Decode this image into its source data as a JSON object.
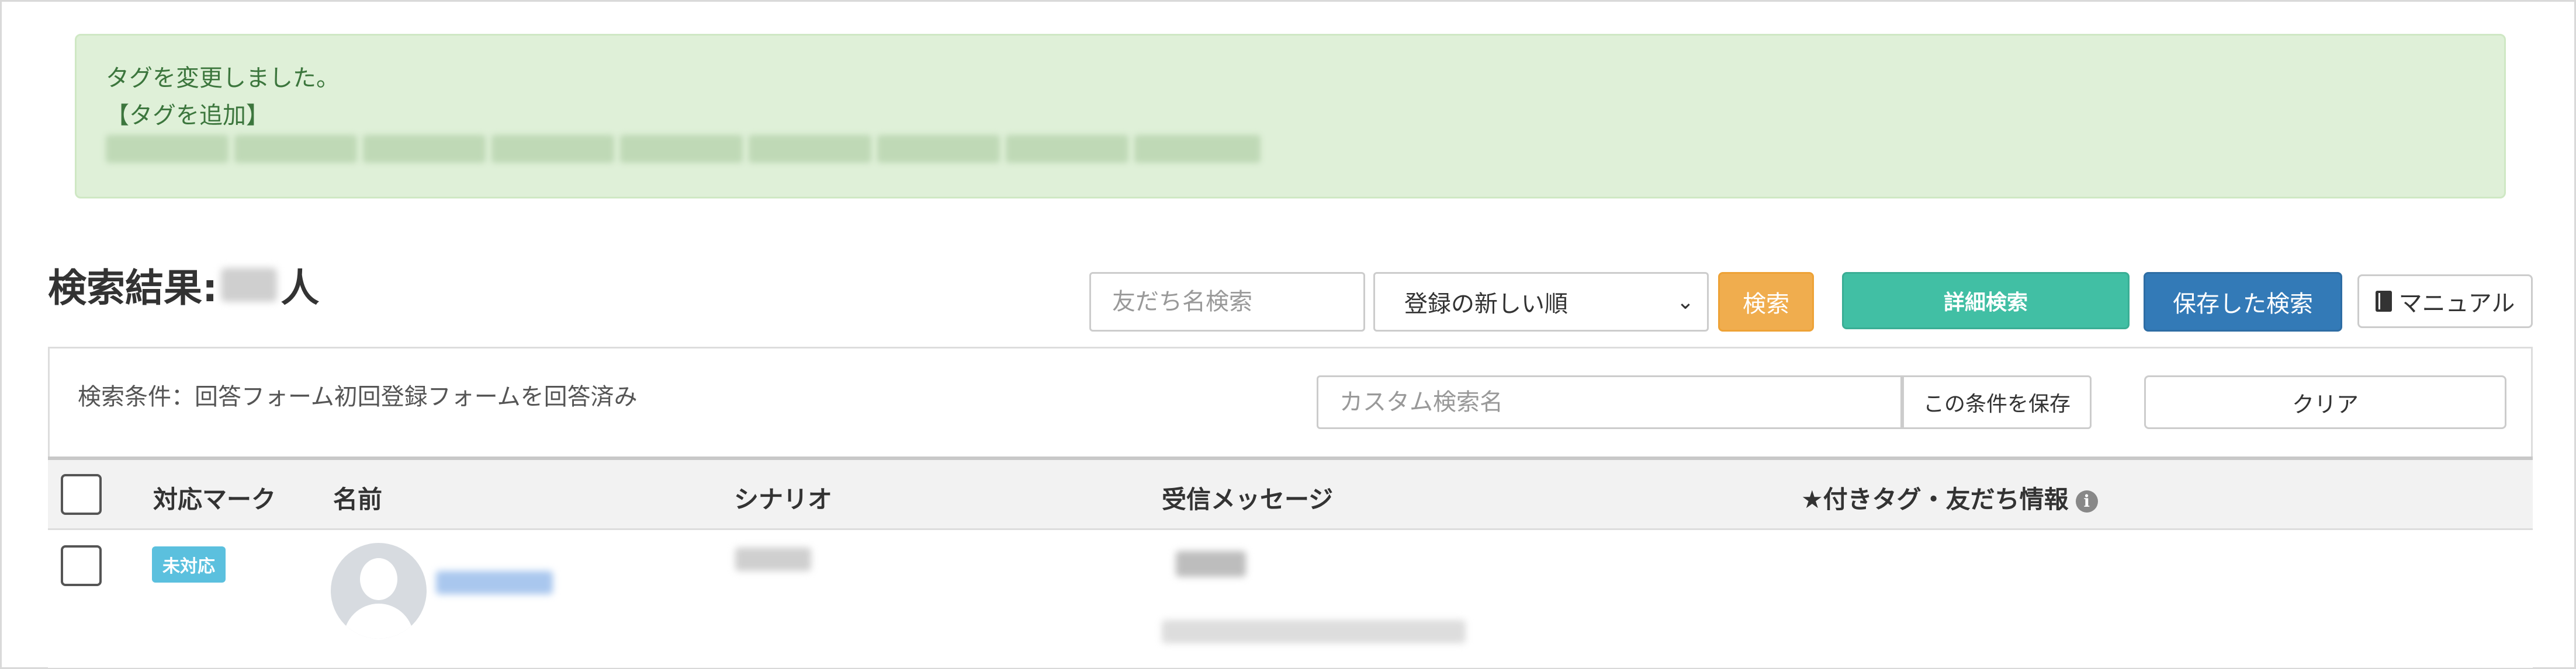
{
  "alert": {
    "message": "タグを変更しました。",
    "added_label": "【タグを追加】"
  },
  "results": {
    "prefix": "検索結果:",
    "suffix": "人"
  },
  "toolbar": {
    "friend_search_placeholder": "友だち名検索",
    "sort_selected": "登録の新しい順",
    "search_button": "検索",
    "detail_search_button": "詳細検索",
    "saved_search_button": "保存した検索",
    "manual_button": "マニュアル"
  },
  "conditions": {
    "text": "検索条件：回答フォーム初回登録フォームを回答済み",
    "custom_name_placeholder": "カスタム検索名",
    "save_button": "この条件を保存",
    "clear_button": "クリア"
  },
  "table": {
    "columns": [
      "対応マーク",
      "名前",
      "シナリオ",
      "受信メッセージ",
      "★付きタグ・友だち情報"
    ],
    "rows": [
      {
        "status_badge": "未対応"
      }
    ]
  },
  "colors": {
    "alert_bg": "#dff0d8",
    "alert_text": "#3c763d",
    "search_button": "#f0ad4e",
    "detail_button": "#41bfa4",
    "saved_button": "#337ab7",
    "badge": "#5bc0de"
  }
}
